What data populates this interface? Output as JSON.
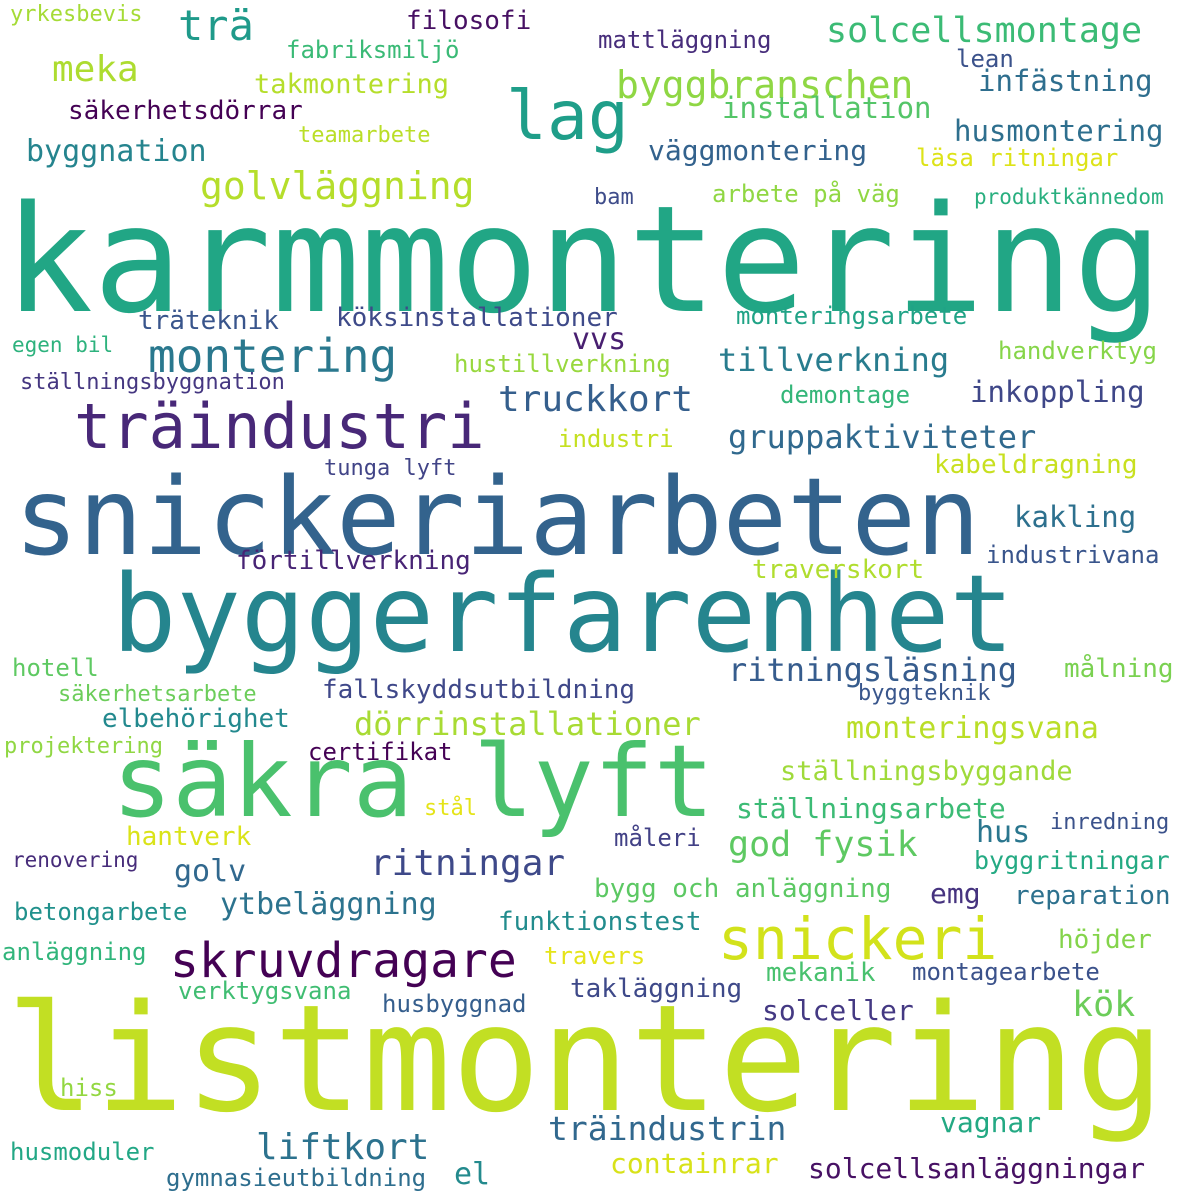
{
  "words": [
    {
      "text": "karmmontering",
      "color": "#21a685"
    },
    {
      "text": "listmontering",
      "color": "#c2df23"
    },
    {
      "text": "snickeriarbeten",
      "color": "#33638d"
    },
    {
      "text": "byggerfarenhet",
      "color": "#25858e"
    },
    {
      "text": "säkra lyft",
      "color": "#4ac16d"
    },
    {
      "text": "snickeri",
      "color": "#d2e21b"
    },
    {
      "text": "träindustri",
      "color": "#482878"
    },
    {
      "text": "lag",
      "color": "#1f9e89"
    },
    {
      "text": "montering",
      "color": "#2a788e"
    },
    {
      "text": "skruvdragare",
      "color": "#440154"
    },
    {
      "text": "byggbranschen",
      "color": "#8fd744"
    },
    {
      "text": "golvläggning",
      "color": "#b5de2b"
    },
    {
      "text": "trä",
      "color": "#1f9a8a"
    },
    {
      "text": "meka",
      "color": "#addc30"
    },
    {
      "text": "solcellsmontage",
      "color": "#3bbb75"
    },
    {
      "text": "byggnation",
      "color": "#25848e"
    },
    {
      "text": "ritningar",
      "color": "#3e4989"
    },
    {
      "text": "truckkort",
      "color": "#355f8d"
    },
    {
      "text": "gruppaktiviteter",
      "color": "#30698e"
    },
    {
      "text": "tillverkning",
      "color": "#287c8e"
    },
    {
      "text": "ritningsläsning",
      "color": "#365c8d"
    },
    {
      "text": "dörrinstallationer",
      "color": "#a8db34"
    },
    {
      "text": "god fysik",
      "color": "#5ec962"
    },
    {
      "text": "liftkort",
      "color": "#2c728e"
    },
    {
      "text": "träindustrin",
      "color": "#31688e"
    },
    {
      "text": "köksinstallationer",
      "color": "#3e4a89"
    },
    {
      "text": "vvs",
      "color": "#481f70"
    },
    {
      "text": "filosofi",
      "color": "#471063"
    },
    {
      "text": "fabriksmiljö",
      "color": "#3aba76"
    },
    {
      "text": "takmontering",
      "color": "#b5de2b"
    },
    {
      "text": "säkerhetsdörrar",
      "color": "#440154"
    },
    {
      "text": "teamarbete",
      "color": "#bade28"
    },
    {
      "text": "yrkesbevis",
      "color": "#a5db36"
    },
    {
      "text": "mattläggning",
      "color": "#472d7b"
    },
    {
      "text": "lean",
      "color": "#3b528b"
    },
    {
      "text": "infästning",
      "color": "#2e6e8e"
    },
    {
      "text": "installation",
      "color": "#54c568"
    },
    {
      "text": "husmontering",
      "color": "#2e6f8e"
    },
    {
      "text": "väggmontering",
      "color": "#33628d"
    },
    {
      "text": "läsa ritningar",
      "color": "#dde318"
    },
    {
      "text": "bam",
      "color": "#3e4c8a"
    },
    {
      "text": "arbete på väg",
      "color": "#90d743"
    },
    {
      "text": "produktkännedom",
      "color": "#29af7f"
    },
    {
      "text": "träteknik",
      "color": "#39558c"
    },
    {
      "text": "monteringsarbete",
      "color": "#20a386"
    },
    {
      "text": "egen bil",
      "color": "#2db27d"
    },
    {
      "text": "hustillverkning",
      "color": "#98d83e"
    },
    {
      "text": "handverktyg",
      "color": "#86d549"
    },
    {
      "text": "ställningsbyggnation",
      "color": "#453781"
    },
    {
      "text": "demontage",
      "color": "#34b679"
    },
    {
      "text": "inkoppling",
      "color": "#3f4788"
    },
    {
      "text": "industri",
      "color": "#c5e021"
    },
    {
      "text": "tunga lyft",
      "color": "#414487"
    },
    {
      "text": "kabeldragning",
      "color": "#c8e020"
    },
    {
      "text": "kakling",
      "color": "#2d708e"
    },
    {
      "text": "industrivana",
      "color": "#39558c"
    },
    {
      "text": "förtillverkning",
      "color": "#482475"
    },
    {
      "text": "traverskort",
      "color": "#b0dd2f"
    },
    {
      "text": "hotell",
      "color": "#5ec962"
    },
    {
      "text": "målning",
      "color": "#7ad151"
    },
    {
      "text": "säkerhetsarbete",
      "color": "#6ccd5a"
    },
    {
      "text": "fallskyddsutbildning",
      "color": "#3f4889"
    },
    {
      "text": "byggteknik",
      "color": "#39568c"
    },
    {
      "text": "elbehörighet",
      "color": "#23898e"
    },
    {
      "text": "monteringsvana",
      "color": "#bade28"
    },
    {
      "text": "projektering",
      "color": "#90d743"
    },
    {
      "text": "certifikat",
      "color": "#440154"
    },
    {
      "text": "ställningsbyggande",
      "color": "#9fda3a"
    },
    {
      "text": "ställningsarbete",
      "color": "#3cbb75"
    },
    {
      "text": "hantverk",
      "color": "#dae319"
    },
    {
      "text": "stål",
      "color": "#e5e419"
    },
    {
      "text": "hus",
      "color": "#2a768e"
    },
    {
      "text": "inredning",
      "color": "#3b528b"
    },
    {
      "text": "måleri",
      "color": "#424186"
    },
    {
      "text": "golv",
      "color": "#31688e"
    },
    {
      "text": "renovering",
      "color": "#472c7a"
    },
    {
      "text": "byggritningar",
      "color": "#24aa83"
    },
    {
      "text": "bygg och anläggning",
      "color": "#5cc863"
    },
    {
      "text": "emg",
      "color": "#46337f"
    },
    {
      "text": "ytbeläggning",
      "color": "#2c738e"
    },
    {
      "text": "reparation",
      "color": "#2d718e"
    },
    {
      "text": "betongarbete",
      "color": "#21918c"
    },
    {
      "text": "funktionstest",
      "color": "#228c8d"
    },
    {
      "text": "anläggning",
      "color": "#31b57b"
    },
    {
      "text": "travers",
      "color": "#e5e419"
    },
    {
      "text": "höjder",
      "color": "#84d44b"
    },
    {
      "text": "mekanik",
      "color": "#48c16e"
    },
    {
      "text": "montagearbete",
      "color": "#3b528b"
    },
    {
      "text": "verktygsvana",
      "color": "#40bd72"
    },
    {
      "text": "takläggning",
      "color": "#3e4989"
    },
    {
      "text": "husbyggnad",
      "color": "#355e8d"
    },
    {
      "text": "solceller",
      "color": "#443983"
    },
    {
      "text": "kök",
      "color": "#6ccd5a"
    },
    {
      "text": "hiss",
      "color": "#93d741"
    },
    {
      "text": "vagnar",
      "color": "#23a983"
    },
    {
      "text": "husmoduler",
      "color": "#22a785"
    },
    {
      "text": "gymnasieutbildning",
      "color": "#2e6e8e"
    },
    {
      "text": "el",
      "color": "#238a8d"
    },
    {
      "text": "containrar",
      "color": "#d8e219"
    },
    {
      "text": "solcellsanläggningar",
      "color": "#471164"
    }
  ]
}
